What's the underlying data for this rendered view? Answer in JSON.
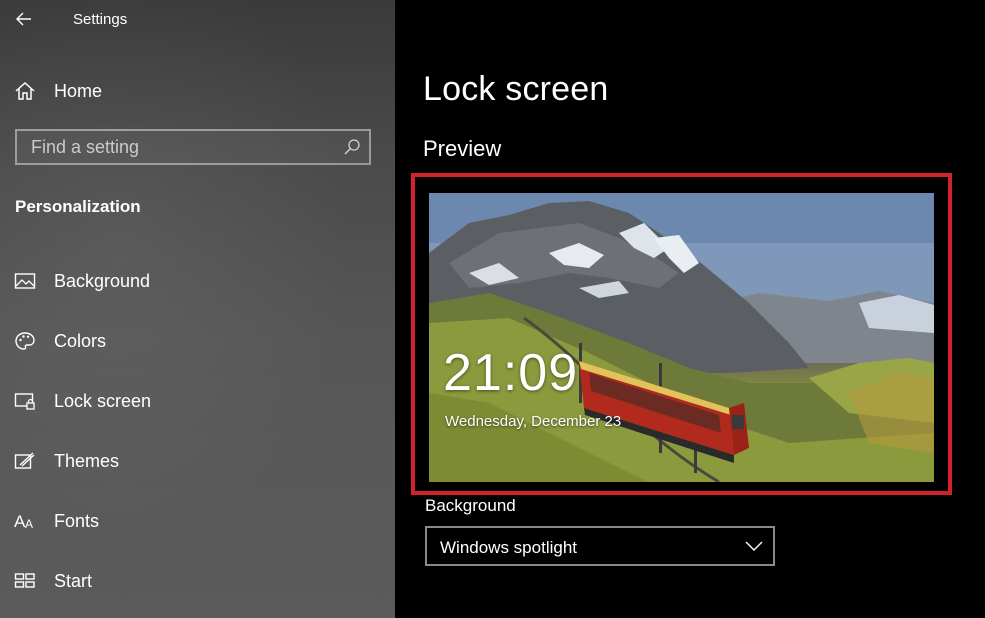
{
  "window": {
    "title": "Settings"
  },
  "sidebar": {
    "home_label": "Home",
    "search_placeholder": "Find a setting",
    "section_header": "Personalization",
    "items": [
      {
        "label": "Background",
        "icon": "picture-icon"
      },
      {
        "label": "Colors",
        "icon": "palette-icon"
      },
      {
        "label": "Lock screen",
        "icon": "lock-screen-icon"
      },
      {
        "label": "Themes",
        "icon": "themes-icon"
      },
      {
        "label": "Fonts",
        "icon": "fonts-icon"
      },
      {
        "label": "Start",
        "icon": "start-icon"
      }
    ]
  },
  "main": {
    "title": "Lock screen",
    "preview_heading": "Preview",
    "preview": {
      "time": "21:09",
      "date": "Wednesday, December 23"
    },
    "background_label": "Background",
    "background_value": "Windows spotlight"
  },
  "colors": {
    "highlight_border": "#d2232c",
    "sidebar_bg": "#4a4a4a",
    "main_bg": "#000000"
  }
}
